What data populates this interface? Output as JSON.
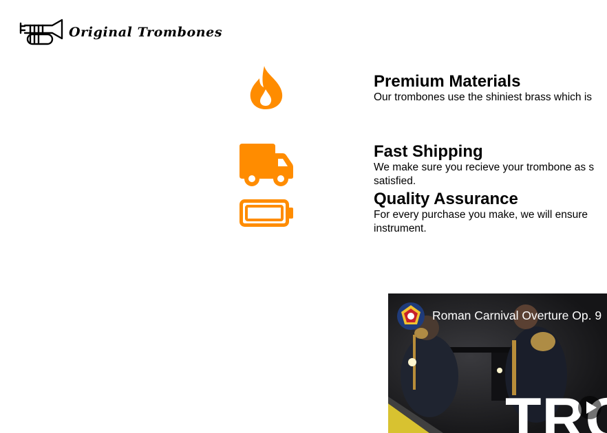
{
  "header": {
    "logo_icon": "trumpet-icon",
    "brand": "Original Trombones"
  },
  "features": [
    {
      "icon": "flame-icon",
      "title": "Premium Materials",
      "description": "Our trombones use the shiniest brass which is"
    },
    {
      "icon": "truck-icon",
      "title": "Fast Shipping",
      "description": "We make sure you recieve your trombone as s satisfied."
    },
    {
      "icon": "battery-icon",
      "title": "Quality Assurance",
      "description": "For every purchase you make, we will ensure instrument."
    }
  ],
  "video": {
    "title": "Roman Carnival Overture Op. 9",
    "overlay_text": "TRO",
    "channel_icon": "band-emblem-icon",
    "play_icon": "play-icon"
  },
  "colors": {
    "accent": "#ff8c00",
    "text": "#000000",
    "background": "#ffffff"
  }
}
